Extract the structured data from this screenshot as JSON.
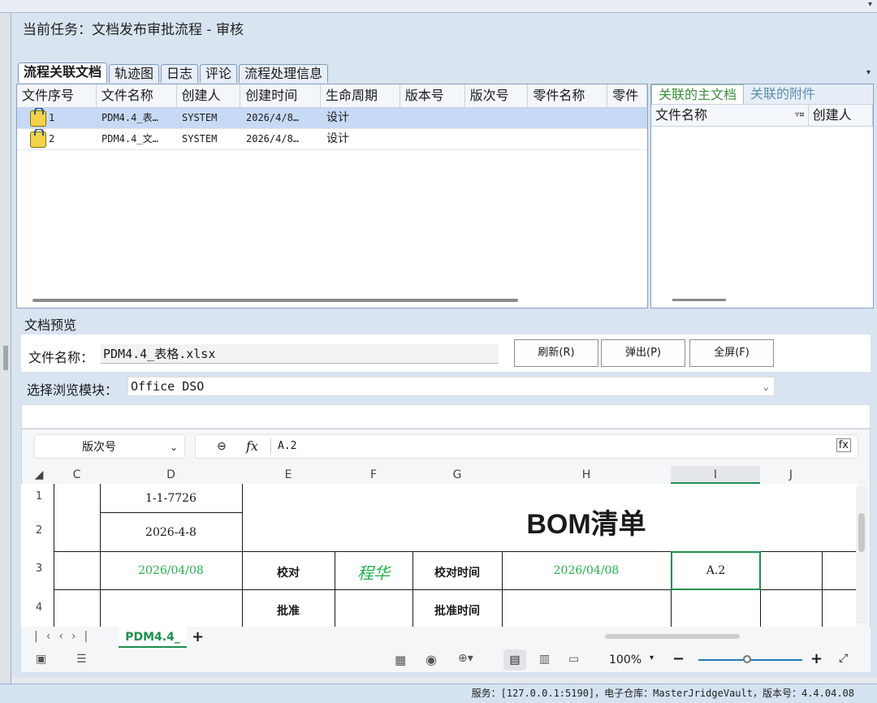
{
  "task": {
    "label": "当前任务：文档发布审批流程 - 审核"
  },
  "tabs": [
    "流程关联文档",
    "轨迹图",
    "日志",
    "评论",
    "流程处理信息"
  ],
  "grid": {
    "columns": [
      "文件序号",
      "文件名称",
      "创建人",
      "创建时间",
      "生命周期",
      "版本号",
      "版次号",
      "零件名称",
      "零件"
    ],
    "rows": [
      {
        "seq": "1",
        "name": "PDM4.4_表…",
        "creator": "SYSTEM",
        "created": "2026/4/8…",
        "lifecycle": "设计"
      },
      {
        "seq": "2",
        "name": "PDM4.4_文…",
        "creator": "SYSTEM",
        "created": "2026/4/8…",
        "lifecycle": "设计"
      }
    ]
  },
  "right_pane": {
    "tabs": [
      "关联的主文档",
      "关联的附件"
    ],
    "columns": [
      "文件名称",
      "创建人"
    ]
  },
  "preview": {
    "title": "文档预览",
    "file_label": "文件名称：",
    "file_value": "PDM4.4_表格.xlsx",
    "refresh": "刷新(R)",
    "popup": "弹出(P)",
    "fullscreen": "全屏(F)",
    "module_label": "选择浏览模块：",
    "module_value": "Office DSO"
  },
  "sheet": {
    "name_box": "版次号",
    "formula_value": "A.2",
    "fx": "fx",
    "columns": [
      "C",
      "D",
      "E",
      "F",
      "G",
      "H",
      "I",
      "J"
    ],
    "rows": [
      "1",
      "2",
      "3",
      "4"
    ],
    "d1": "1-1-7726",
    "d2": "2026-4-8",
    "title": "BOM清单",
    "d3": "2026/04/08",
    "e3": "校对",
    "f3": "程华",
    "g3": "校对时间",
    "h3": "2026/04/08",
    "i3": "A.2",
    "e4": "批准",
    "g4": "批准时间",
    "sheet_tab": "PDM4.4_",
    "zoom": "100%"
  },
  "colors": {
    "green": "#22b14c",
    "accent": "#1f8f4f"
  },
  "status": "服务：[127.0.0.1:5190]，电子仓库：MasterJridgeVault，版本号：4.4.04.08"
}
